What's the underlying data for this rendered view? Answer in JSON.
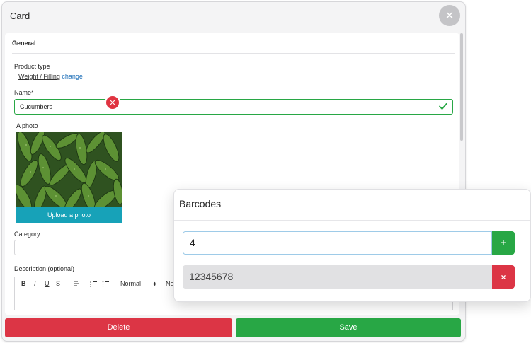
{
  "card": {
    "title": "Card",
    "close_icon": "close-icon",
    "section_title": "General",
    "product_type": {
      "label": "Product type",
      "value": "Weight / Filling",
      "change_link": "change"
    },
    "name": {
      "label": "Name*",
      "value": "Cucumbers"
    },
    "photo": {
      "label": "A photo",
      "upload_label": "Upload a photo"
    },
    "category": {
      "label": "Category",
      "value": ""
    },
    "description": {
      "label": "Description (optional)",
      "toolbar": {
        "bold": "B",
        "italic": "I",
        "underline": "U",
        "strike": "S",
        "style_1": "Normal",
        "style_2": "Normal"
      }
    },
    "actions": {
      "delete_label": "Delete",
      "save_label": "Save"
    },
    "colors": {
      "delete": "#dc3545",
      "save": "#28a745",
      "upload": "#17a2b8"
    }
  },
  "barcodes": {
    "title": "Barcodes",
    "input_value": "4",
    "add_label": "+",
    "items": [
      {
        "code": "12345678",
        "remove_label": "×"
      }
    ]
  }
}
